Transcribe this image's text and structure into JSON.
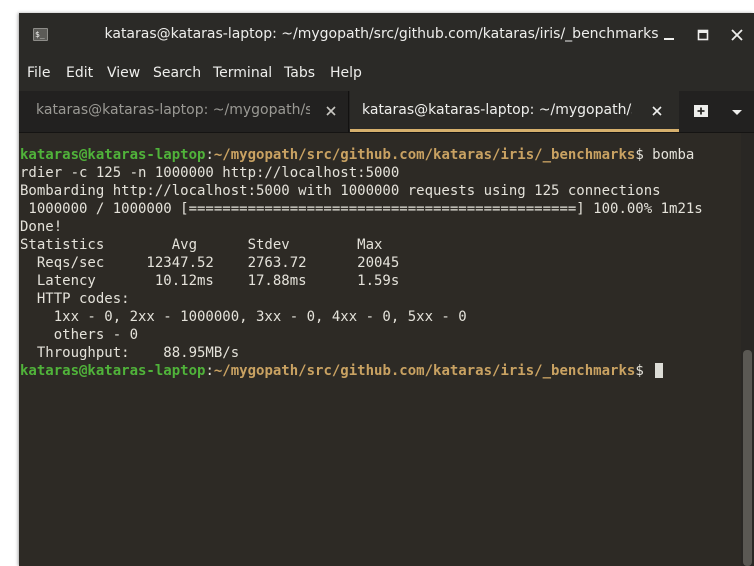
{
  "window": {
    "title": "kataras@kataras-laptop: ~/mygopath/src/github.com/kataras/iris/_benchmarks",
    "icon_label": "$_"
  },
  "menu": [
    "File",
    "Edit",
    "View",
    "Search",
    "Terminal",
    "Tabs",
    "Help"
  ],
  "tabs": [
    {
      "label": "kataras@kataras-laptop: ~/mygopath/src...",
      "active": false
    },
    {
      "label": "kataras@kataras-laptop: ~/mygopath/src...",
      "active": true
    }
  ],
  "terminal": {
    "prompt_user": "kataras@kataras-laptop",
    "prompt_sep": ":",
    "prompt_path": "~/mygopath/src/github.com/kataras/iris/_benchmarks",
    "prompt_symbol": "$ ",
    "command_part1": "bomba",
    "command_part2": "rdier -c 125 -n 1000000 http://localhost:5000",
    "output": [
      "Bombarding http://localhost:5000 with 1000000 requests using 125 connections",
      " 1000000 / 1000000 [==============================================] 100.00% 1m21s",
      "Done!",
      "Statistics        Avg      Stdev        Max",
      "  Reqs/sec     12347.52    2763.72      20045",
      "  Latency       10.12ms    17.88ms      1.59s",
      "  HTTP codes:",
      "    1xx - 0, 2xx - 1000000, 3xx - 0, 4xx - 0, 5xx - 0",
      "    others - 0",
      "  Throughput:    88.95MB/s"
    ]
  },
  "colors": {
    "prompt_user": "#50b33a",
    "prompt_path": "#c9a262",
    "active_tab_accent": "#d6b06d",
    "terminal_bg": "#2d2a25"
  }
}
